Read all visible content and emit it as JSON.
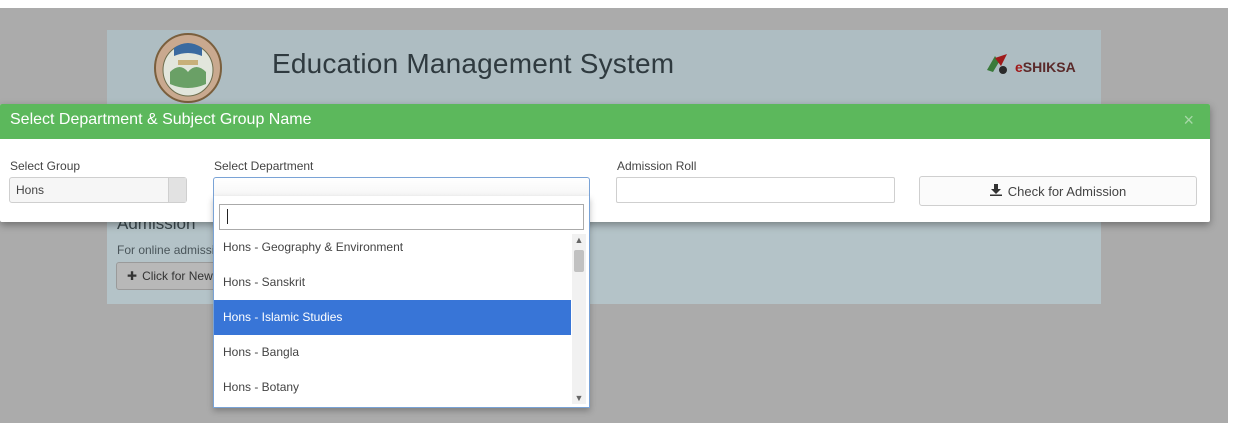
{
  "app": {
    "title": "Education Management System",
    "brand": "eSHIKSA",
    "brand_prefix": "e",
    "brand_rest": "SHIKSA"
  },
  "background_page": {
    "admission_heading": "Admission",
    "admission_text": "For online admission",
    "new_button_label": "Click for New Admission",
    "new_button_icon": "plus-icon"
  },
  "modal": {
    "title": "Select Department & Subject Group Name",
    "close_label": "×",
    "header_color": "#5cb85c"
  },
  "form": {
    "group_label": "Select Group",
    "group_value": "Hons",
    "department_label": "Select Department",
    "department_value": "",
    "admission_roll_label": "Admission Roll",
    "admission_roll_value": "",
    "check_button_label": "Check for Admission",
    "check_button_icon": "download-icon"
  },
  "dropdown": {
    "search_value": "",
    "highlight_color": "#3875d7",
    "options": [
      {
        "label": "Hons - Geography & Environment",
        "highlighted": false
      },
      {
        "label": "Hons - Sanskrit",
        "highlighted": false
      },
      {
        "label": "Hons - Islamic Studies",
        "highlighted": true
      },
      {
        "label": "Hons - Bangla",
        "highlighted": false
      },
      {
        "label": "Hons - Botany",
        "highlighted": false
      }
    ]
  }
}
